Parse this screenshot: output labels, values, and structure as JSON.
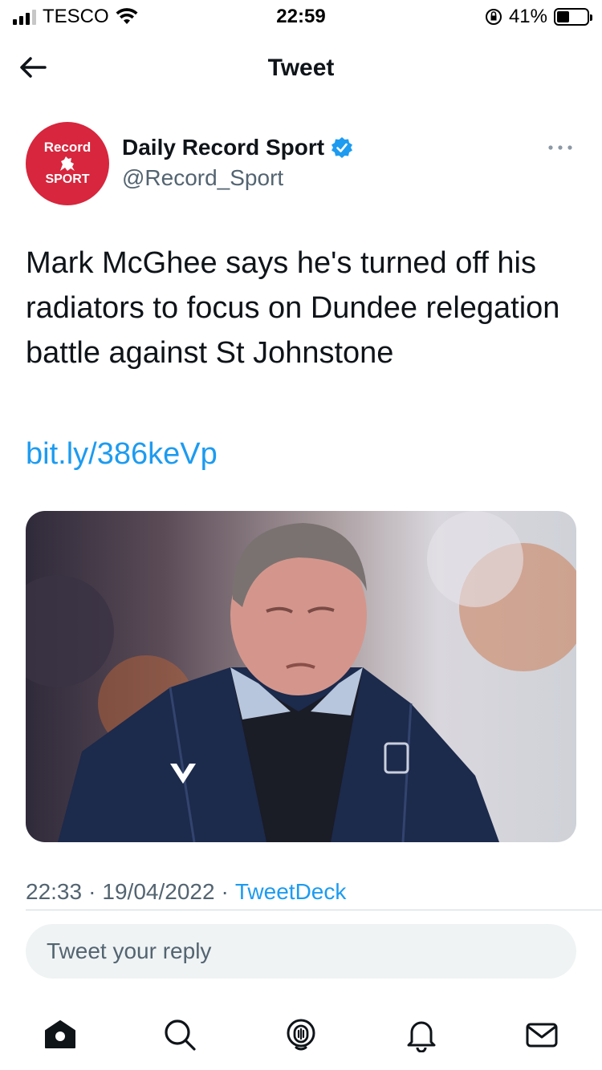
{
  "status_bar": {
    "carrier": "TESCO",
    "time": "22:59",
    "battery": "41%",
    "battery_level": 0.41
  },
  "header": {
    "title": "Tweet"
  },
  "author": {
    "avatar_top": "Record",
    "avatar_bottom": "SPORT",
    "name": "Daily Record Sport",
    "handle": "@Record_Sport",
    "verified": true
  },
  "tweet": {
    "text": "Mark McGhee says he's turned off his radiators to focus on Dundee relegation battle against St Johnstone",
    "link": "bit.ly/386keVp",
    "time": "22:33",
    "separator": "·",
    "date": "19/04/2022",
    "source": "TweetDeck"
  },
  "reply": {
    "placeholder": "Tweet your reply"
  },
  "tabs": [
    "home-icon",
    "search-icon",
    "spaces-icon",
    "notifications-icon",
    "messages-icon"
  ],
  "colors": {
    "accent": "#1d9bf0",
    "avatar_bg": "#d7263d",
    "secondary_text": "#536471"
  }
}
